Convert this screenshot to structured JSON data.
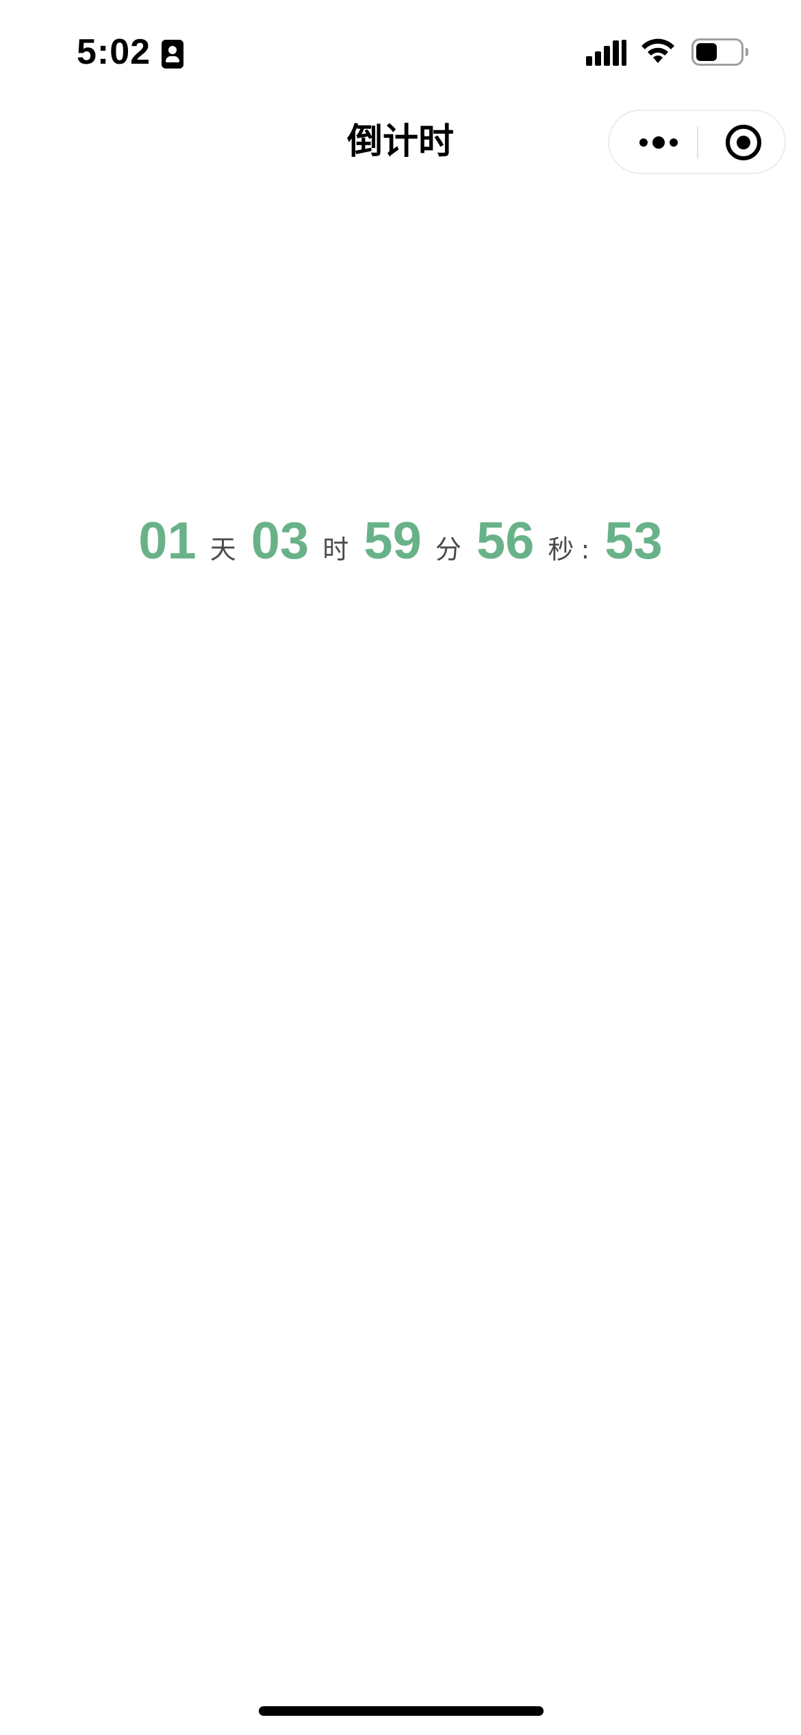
{
  "status_bar": {
    "time": "5:02"
  },
  "nav": {
    "title": "倒计时"
  },
  "countdown": {
    "days": "01",
    "days_unit": "天",
    "hours": "03",
    "hours_unit": "时",
    "minutes": "59",
    "minutes_unit": "分",
    "seconds": "56",
    "seconds_unit": "秒",
    "separator": ":",
    "ms": "53"
  },
  "colors": {
    "number_green": "#69b289",
    "unit_gray": "#4a4a4a"
  }
}
